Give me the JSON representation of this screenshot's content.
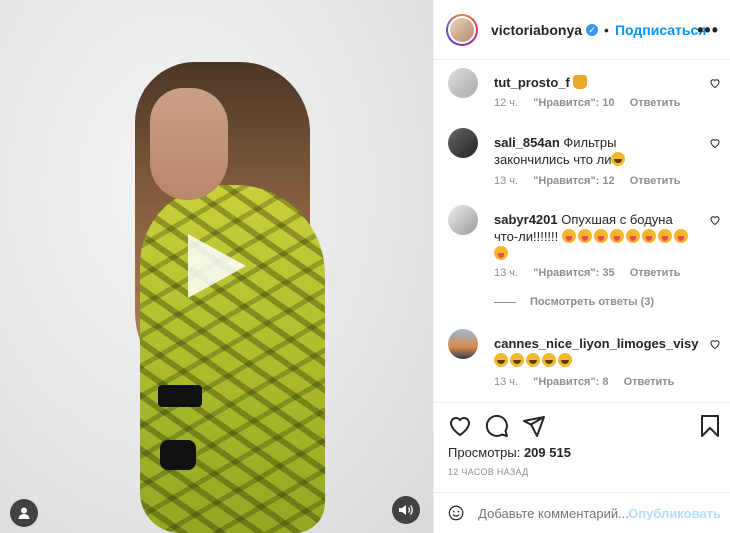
{
  "post": {
    "username": "victoriabonya",
    "verified_mark": "✓",
    "dot": "•",
    "follow_label": "Подписаться",
    "more_label": "•••"
  },
  "comments": [
    {
      "user": "tut_prosto_f",
      "text": "",
      "emoji": [
        "hand"
      ],
      "time": "12 ч.",
      "likes": "\"Нравится\": 10",
      "reply": "Ответить"
    },
    {
      "user": "sali_854an",
      "text": "Фильтры закончились что ли",
      "emoji": [
        "laugh"
      ],
      "time": "13 ч.",
      "likes": "\"Нравится\": 12",
      "reply": "Ответить"
    },
    {
      "user": "sabyr4201",
      "text": "Опухшая с бодуна что-ли!!!!!!!",
      "emoji": [
        "tongue",
        "tongue",
        "tongue",
        "tongue",
        "tongue",
        "tongue",
        "tongue",
        "tongue",
        "tongue"
      ],
      "time": "13 ч.",
      "likes": "\"Нравится\": 35",
      "reply": "Ответить"
    },
    {
      "user": "cannes_nice_liyon_limoges_visy",
      "text": "",
      "emoji": [
        "laugh",
        "laugh",
        "laugh",
        "laugh",
        "laugh"
      ],
      "time": "13 ч.",
      "likes": "\"Нравится\": 8",
      "reply": "Ответить"
    }
  ],
  "view_replies": "Посмотреть ответы (3)",
  "views": {
    "label": "Просмотры:",
    "count": "209 515"
  },
  "time_ago": "12 ЧАСОВ НАЗАД",
  "add_comment": {
    "placeholder": "Добавьте комментарий...",
    "publish": "Опубликовать"
  },
  "icons": {
    "like": "heart-icon",
    "comment": "comment-icon",
    "share": "share-icon",
    "save": "bookmark-icon",
    "emoji": "smile-icon",
    "play": "play-icon",
    "sound": "speaker-icon",
    "user": "user-icon"
  },
  "colors": {
    "accent": "#0095f6",
    "muted": "#8e8e8e",
    "publish_disabled": "#b2dffc"
  }
}
